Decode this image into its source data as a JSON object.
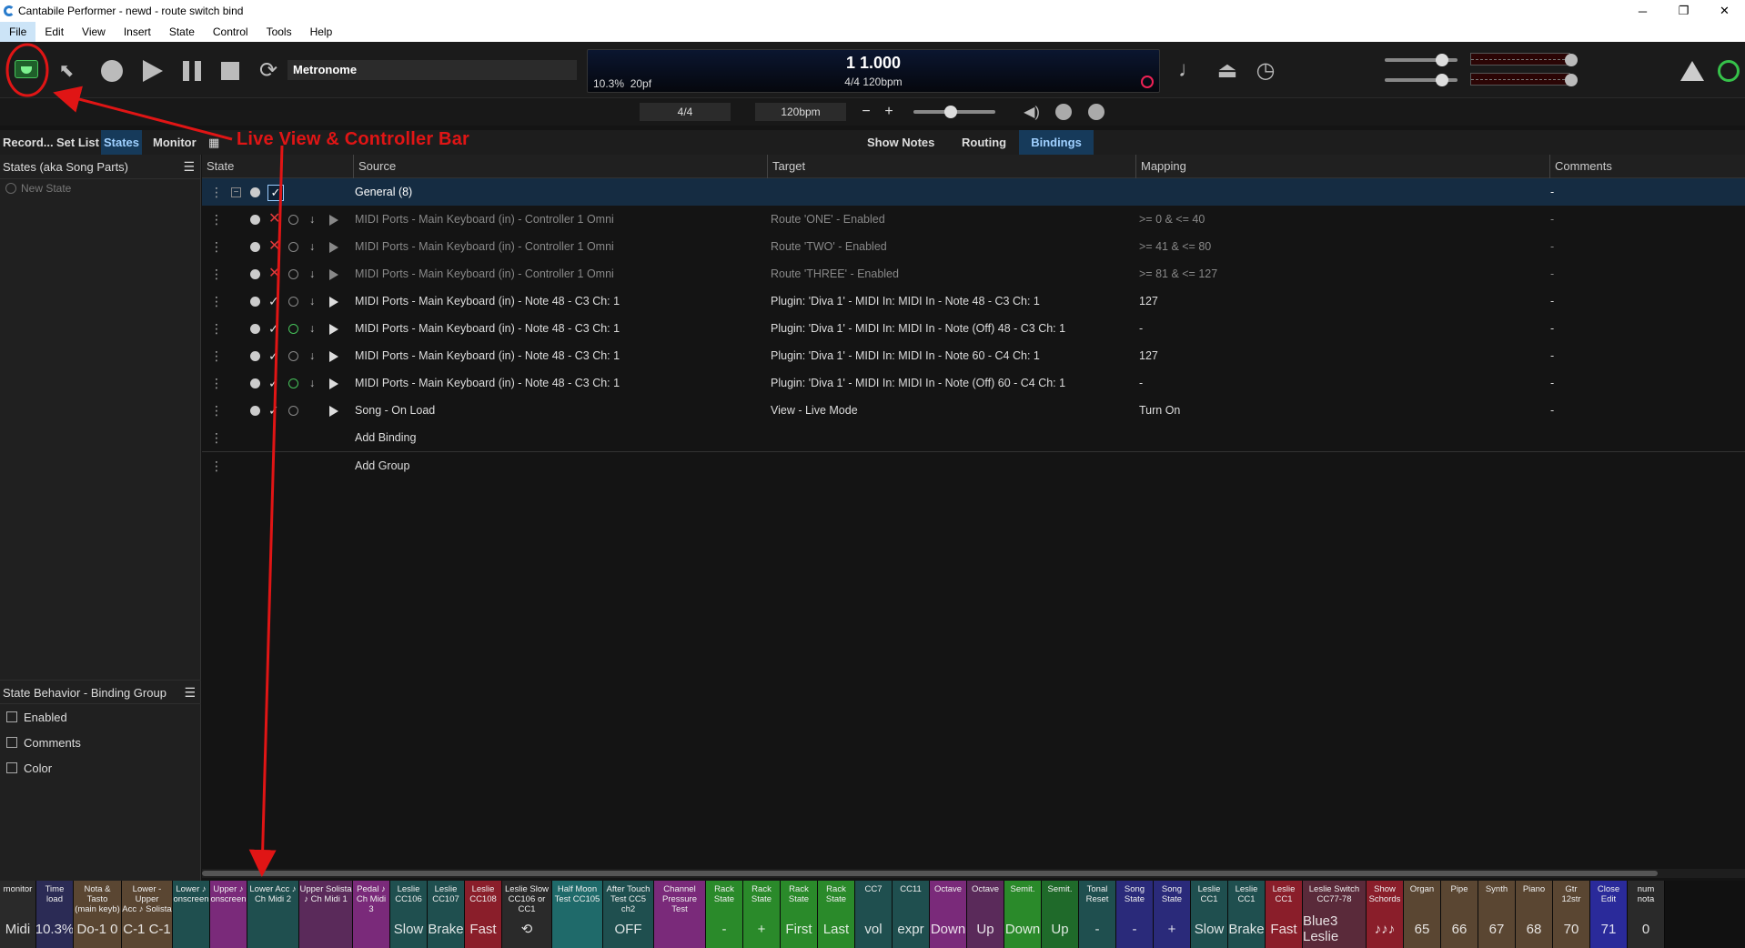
{
  "window": {
    "title": "Cantabile Performer - newd - route switch bind",
    "controls": [
      "─",
      "❐",
      "✕"
    ]
  },
  "menu": [
    "File",
    "Edit",
    "View",
    "Insert",
    "State",
    "Control",
    "Tools",
    "Help"
  ],
  "toolbar": {
    "metronome_label": "Metronome",
    "position": "1 1.000",
    "time_sig_tempo": "4/4 120bpm",
    "cpu_load": "10.3%",
    "latency": "20pf"
  },
  "subbar": {
    "time_sig": "4/4",
    "tempo": "120bpm",
    "minus": "−",
    "plus": "+"
  },
  "tabs_left": [
    "Record...",
    "Set List",
    "States",
    "Monitor"
  ],
  "tabs_right": [
    "Show Notes",
    "Routing",
    "Bindings"
  ],
  "left_panel": {
    "header": "States (aka Song Parts)",
    "new_state": "New State"
  },
  "behavior_panel": {
    "header": "State Behavior - Binding Group",
    "options": [
      "Enabled",
      "Comments",
      "Color"
    ]
  },
  "grid": {
    "columns": [
      "State",
      "Source",
      "Target",
      "Mapping",
      "Comments"
    ],
    "group": {
      "name": "General (8)",
      "comment": "-"
    },
    "rows": [
      {
        "source": "MIDI Ports - Main Keyboard (in) - Controller 1 Omni",
        "target": "Route 'ONE' - Enabled",
        "mapping": ">= 0 & <= 40",
        "comment": "-",
        "enabled": false
      },
      {
        "source": "MIDI Ports - Main Keyboard (in) - Controller 1 Omni",
        "target": "Route 'TWO' - Enabled",
        "mapping": ">= 41 & <= 80",
        "comment": "-",
        "enabled": false
      },
      {
        "source": "MIDI Ports - Main Keyboard (in) - Controller 1 Omni",
        "target": "Route 'THREE' - Enabled",
        "mapping": ">= 81 & <= 127",
        "comment": "-",
        "enabled": false
      },
      {
        "source": "MIDI Ports - Main Keyboard (in) - Note 48 - C3 Ch: 1",
        "target": "Plugin: 'Diva 1' - MIDI In: MIDI In - Note 48 - C3 Ch: 1",
        "mapping": "127",
        "comment": "-",
        "enabled": true
      },
      {
        "source": "MIDI Ports - Main Keyboard (in) - Note 48 - C3 Ch: 1",
        "target": "Plugin: 'Diva 1' - MIDI In: MIDI In - Note (Off) 48 - C3 Ch: 1",
        "mapping": "-",
        "comment": "-",
        "enabled": true
      },
      {
        "source": "MIDI Ports - Main Keyboard (in) - Note 48 - C3 Ch: 1",
        "target": "Plugin: 'Diva 1' - MIDI In: MIDI In - Note 60 - C4 Ch: 1",
        "mapping": "127",
        "comment": "-",
        "enabled": true
      },
      {
        "source": "MIDI Ports - Main Keyboard (in) - Note 48 - C3 Ch: 1",
        "target": "Plugin: 'Diva 1' - MIDI In: MIDI In - Note (Off) 60 - C4 Ch: 1",
        "mapping": "-",
        "comment": "-",
        "enabled": true
      },
      {
        "source": "Song - On Load",
        "target": "View - Live Mode",
        "mapping": "Turn On",
        "comment": "-",
        "enabled": true
      }
    ],
    "add_binding": "Add Binding",
    "add_group": "Add Group"
  },
  "annotation": "Live View & Controller Bar",
  "controller_bar": [
    {
      "label": "monitor",
      "value": "Midi",
      "color": "#2a2a2a"
    },
    {
      "label": "Time load",
      "value": "10.3%",
      "color": "#2b2b55"
    },
    {
      "label": "Nota & Tasto\n(main keyb)",
      "value": "Do-1  0",
      "color": "#5a4632"
    },
    {
      "label": "Lower - Upper\nAcc ♪ Solista",
      "value": "C-1  C-1",
      "color": "#5a4632"
    },
    {
      "label": "Lower ♪\nonscreen",
      "value": "",
      "color": "#1f4f4f"
    },
    {
      "label": "Upper ♪\nonscreen",
      "value": "",
      "color": "#7a2a7a"
    },
    {
      "label": "Lower Acc ♪\nCh Midi 2",
      "value": "",
      "color": "#1f4f4f"
    },
    {
      "label": "Upper Solista\n♪ Ch Midi 1",
      "value": "",
      "color": "#5a2a5a"
    },
    {
      "label": "Pedal ♪\nCh Midi 3",
      "value": "",
      "color": "#7a2a7a"
    },
    {
      "label": "Leslie\nCC106",
      "value": "Slow",
      "color": "#1f4f4f"
    },
    {
      "label": "Leslie\nCC107",
      "value": "Brake",
      "color": "#1f4f4f"
    },
    {
      "label": "Leslie\nCC108",
      "value": "Fast",
      "color": "#8a1e2a"
    },
    {
      "label": "Leslie Slow\nCC106 or CC1",
      "value": "⟲",
      "color": "#2a2a2a"
    },
    {
      "label": "Half Moon\nTest CC105",
      "value": "",
      "color": "#1f6a6a"
    },
    {
      "label": "After Touch\nTest CC5 ch2",
      "value": "OFF",
      "color": "#1f4f4f"
    },
    {
      "label": "Channel\nPressure Test",
      "value": "",
      "color": "#7a2a7a"
    },
    {
      "label": "Rack\nState",
      "value": "-",
      "color": "#2a8a2a"
    },
    {
      "label": "Rack\nState",
      "value": "+",
      "color": "#2a8a2a"
    },
    {
      "label": "Rack\nState",
      "value": "First",
      "color": "#2a8a2a"
    },
    {
      "label": "Rack\nState",
      "value": "Last",
      "color": "#2a8a2a"
    },
    {
      "label": "CC7",
      "value": "vol",
      "color": "#1f4f4f"
    },
    {
      "label": "CC11",
      "value": "expr",
      "color": "#1f4f4f"
    },
    {
      "label": "Octave",
      "value": "Down",
      "color": "#7a2a7a"
    },
    {
      "label": "Octave",
      "value": "Up",
      "color": "#5a2a5a"
    },
    {
      "label": "Semit.",
      "value": "Down",
      "color": "#2a8a2a"
    },
    {
      "label": "Semit.",
      "value": "Up",
      "color": "#1f6a2a"
    },
    {
      "label": "Tonal\nReset",
      "value": "-",
      "color": "#1f4f4f"
    },
    {
      "label": "Song\nState",
      "value": "-",
      "color": "#2a2a7a"
    },
    {
      "label": "Song\nState",
      "value": "+",
      "color": "#2a2a7a"
    },
    {
      "label": "Leslie\nCC1",
      "value": "Slow",
      "color": "#1f4f4f"
    },
    {
      "label": "Leslie\nCC1",
      "value": "Brake",
      "color": "#1f4f4f"
    },
    {
      "label": "Leslie\nCC1",
      "value": "Fast",
      "color": "#8a1e2a"
    },
    {
      "label": "Leslie Switch\nCC77-78",
      "value": "Blue3 Leslie",
      "color": "#5a2a3a"
    },
    {
      "label": "Show\nSchords",
      "value": "♪♪♪",
      "color": "#8a1e2a"
    },
    {
      "label": "Organ",
      "value": "65",
      "color": "#5a4632"
    },
    {
      "label": "Pipe",
      "value": "66",
      "color": "#5a4632"
    },
    {
      "label": "Synth",
      "value": "67",
      "color": "#5a4632"
    },
    {
      "label": "Piano",
      "value": "68",
      "color": "#5a4632"
    },
    {
      "label": "Gtr\n12str",
      "value": "70",
      "color": "#5a4632"
    },
    {
      "label": "Close\nEdit",
      "value": "71",
      "color": "#2a2a9a"
    },
    {
      "label": "num\nnota",
      "value": "0",
      "color": "#2a2a2a"
    }
  ]
}
